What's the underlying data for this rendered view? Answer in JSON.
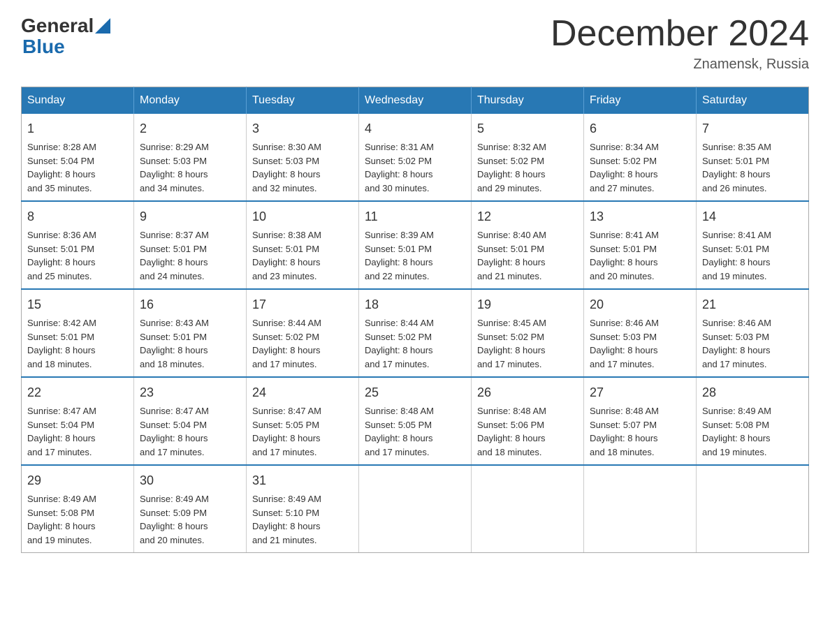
{
  "header": {
    "logo_general": "General",
    "logo_blue": "Blue",
    "month_title": "December 2024",
    "location": "Znamensk, Russia"
  },
  "weekdays": [
    "Sunday",
    "Monday",
    "Tuesday",
    "Wednesday",
    "Thursday",
    "Friday",
    "Saturday"
  ],
  "weeks": [
    [
      {
        "day": "1",
        "sunrise": "8:28 AM",
        "sunset": "5:04 PM",
        "daylight": "8 hours and 35 minutes."
      },
      {
        "day": "2",
        "sunrise": "8:29 AM",
        "sunset": "5:03 PM",
        "daylight": "8 hours and 34 minutes."
      },
      {
        "day": "3",
        "sunrise": "8:30 AM",
        "sunset": "5:03 PM",
        "daylight": "8 hours and 32 minutes."
      },
      {
        "day": "4",
        "sunrise": "8:31 AM",
        "sunset": "5:02 PM",
        "daylight": "8 hours and 30 minutes."
      },
      {
        "day": "5",
        "sunrise": "8:32 AM",
        "sunset": "5:02 PM",
        "daylight": "8 hours and 29 minutes."
      },
      {
        "day": "6",
        "sunrise": "8:34 AM",
        "sunset": "5:02 PM",
        "daylight": "8 hours and 27 minutes."
      },
      {
        "day": "7",
        "sunrise": "8:35 AM",
        "sunset": "5:01 PM",
        "daylight": "8 hours and 26 minutes."
      }
    ],
    [
      {
        "day": "8",
        "sunrise": "8:36 AM",
        "sunset": "5:01 PM",
        "daylight": "8 hours and 25 minutes."
      },
      {
        "day": "9",
        "sunrise": "8:37 AM",
        "sunset": "5:01 PM",
        "daylight": "8 hours and 24 minutes."
      },
      {
        "day": "10",
        "sunrise": "8:38 AM",
        "sunset": "5:01 PM",
        "daylight": "8 hours and 23 minutes."
      },
      {
        "day": "11",
        "sunrise": "8:39 AM",
        "sunset": "5:01 PM",
        "daylight": "8 hours and 22 minutes."
      },
      {
        "day": "12",
        "sunrise": "8:40 AM",
        "sunset": "5:01 PM",
        "daylight": "8 hours and 21 minutes."
      },
      {
        "day": "13",
        "sunrise": "8:41 AM",
        "sunset": "5:01 PM",
        "daylight": "8 hours and 20 minutes."
      },
      {
        "day": "14",
        "sunrise": "8:41 AM",
        "sunset": "5:01 PM",
        "daylight": "8 hours and 19 minutes."
      }
    ],
    [
      {
        "day": "15",
        "sunrise": "8:42 AM",
        "sunset": "5:01 PM",
        "daylight": "8 hours and 18 minutes."
      },
      {
        "day": "16",
        "sunrise": "8:43 AM",
        "sunset": "5:01 PM",
        "daylight": "8 hours and 18 minutes."
      },
      {
        "day": "17",
        "sunrise": "8:44 AM",
        "sunset": "5:02 PM",
        "daylight": "8 hours and 17 minutes."
      },
      {
        "day": "18",
        "sunrise": "8:44 AM",
        "sunset": "5:02 PM",
        "daylight": "8 hours and 17 minutes."
      },
      {
        "day": "19",
        "sunrise": "8:45 AM",
        "sunset": "5:02 PM",
        "daylight": "8 hours and 17 minutes."
      },
      {
        "day": "20",
        "sunrise": "8:46 AM",
        "sunset": "5:03 PM",
        "daylight": "8 hours and 17 minutes."
      },
      {
        "day": "21",
        "sunrise": "8:46 AM",
        "sunset": "5:03 PM",
        "daylight": "8 hours and 17 minutes."
      }
    ],
    [
      {
        "day": "22",
        "sunrise": "8:47 AM",
        "sunset": "5:04 PM",
        "daylight": "8 hours and 17 minutes."
      },
      {
        "day": "23",
        "sunrise": "8:47 AM",
        "sunset": "5:04 PM",
        "daylight": "8 hours and 17 minutes."
      },
      {
        "day": "24",
        "sunrise": "8:47 AM",
        "sunset": "5:05 PM",
        "daylight": "8 hours and 17 minutes."
      },
      {
        "day": "25",
        "sunrise": "8:48 AM",
        "sunset": "5:05 PM",
        "daylight": "8 hours and 17 minutes."
      },
      {
        "day": "26",
        "sunrise": "8:48 AM",
        "sunset": "5:06 PM",
        "daylight": "8 hours and 18 minutes."
      },
      {
        "day": "27",
        "sunrise": "8:48 AM",
        "sunset": "5:07 PM",
        "daylight": "8 hours and 18 minutes."
      },
      {
        "day": "28",
        "sunrise": "8:49 AM",
        "sunset": "5:08 PM",
        "daylight": "8 hours and 19 minutes."
      }
    ],
    [
      {
        "day": "29",
        "sunrise": "8:49 AM",
        "sunset": "5:08 PM",
        "daylight": "8 hours and 19 minutes."
      },
      {
        "day": "30",
        "sunrise": "8:49 AM",
        "sunset": "5:09 PM",
        "daylight": "8 hours and 20 minutes."
      },
      {
        "day": "31",
        "sunrise": "8:49 AM",
        "sunset": "5:10 PM",
        "daylight": "8 hours and 21 minutes."
      },
      null,
      null,
      null,
      null
    ]
  ],
  "labels": {
    "sunrise_prefix": "Sunrise: ",
    "sunset_prefix": "Sunset: ",
    "daylight_prefix": "Daylight: "
  }
}
